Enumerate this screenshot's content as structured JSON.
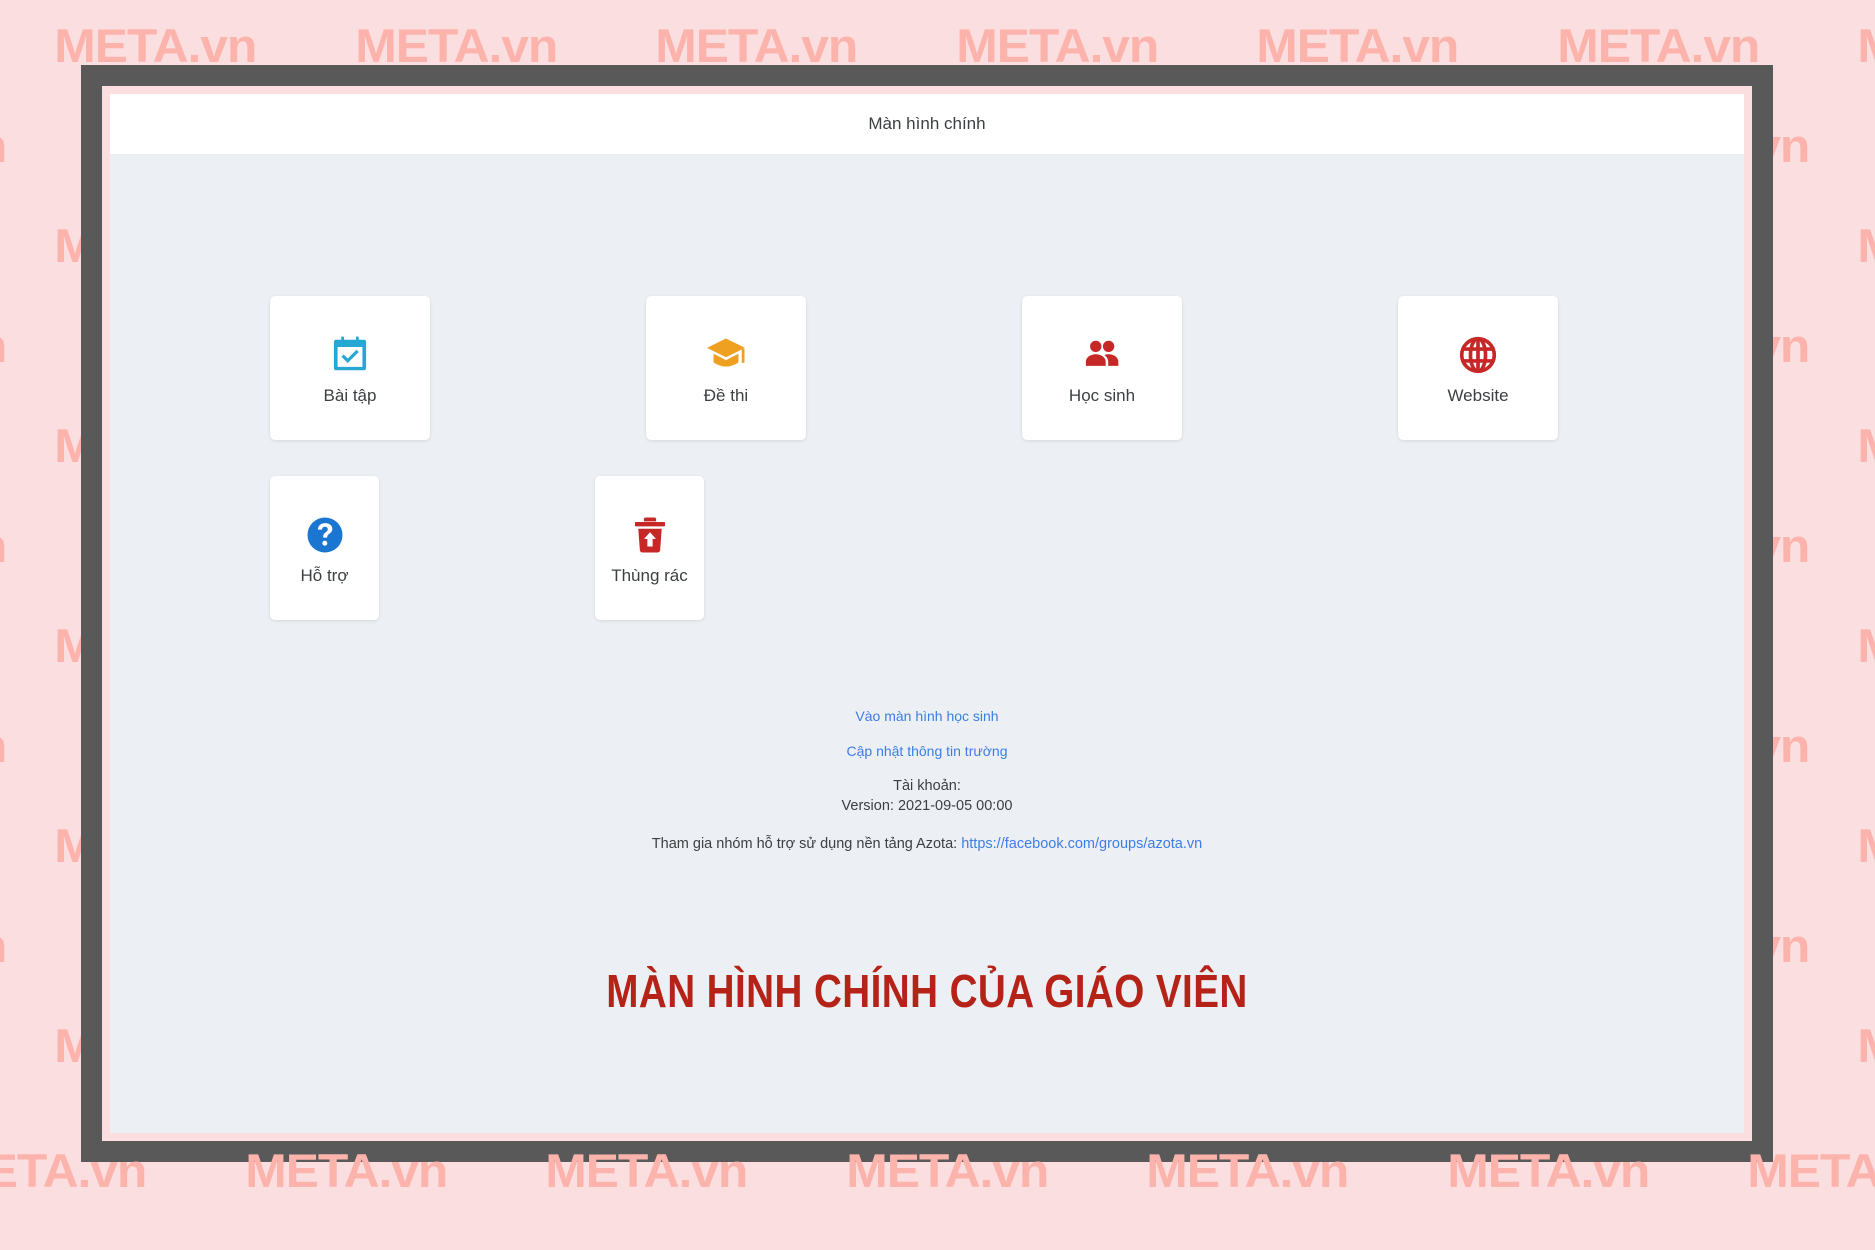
{
  "watermark": {
    "text": "META.vn",
    "color": "#fcb3ac",
    "background": "#fbdfe0"
  },
  "window": {
    "frame_color": "#59595a",
    "background": "#eceff3",
    "title_bar_background": "#ffffff",
    "title": "Màn hình chính"
  },
  "tiles": [
    [
      {
        "label": "Bài tập",
        "icon": "calendar-check-icon",
        "color": "#25a8d4"
      },
      {
        "label": "Đề thi",
        "icon": "graduation-cap-icon",
        "color": "#f0a020"
      },
      {
        "label": "Học sinh",
        "icon": "people-icon",
        "color": "#c62828"
      },
      {
        "label": "Website",
        "icon": "globe-icon",
        "color": "#c62828"
      }
    ],
    [
      {
        "label": "Hỗ trợ",
        "icon": "question-circle-icon",
        "color": "#1b76d2"
      },
      {
        "label": "Thùng rác",
        "icon": "trash-restore-icon",
        "color": "#c62828"
      }
    ]
  ],
  "footer": {
    "link_student_screen": "Vào màn hình học sinh",
    "link_update_school": "Cập nhật thông tin trường",
    "account_label": "Tài khoản:",
    "version_label": "Version: 2021-09-05 00:00",
    "group_prefix": "Tham gia nhóm hỗ trợ sử dụng nền tảng Azota: ",
    "group_url": "https://facebook.com/groups/azota.vn",
    "link_color": "#3c7ee8"
  },
  "caption": {
    "text": "MÀN HÌNH CHÍNH CỦA GIÁO VIÊN",
    "color": "#b52318"
  }
}
